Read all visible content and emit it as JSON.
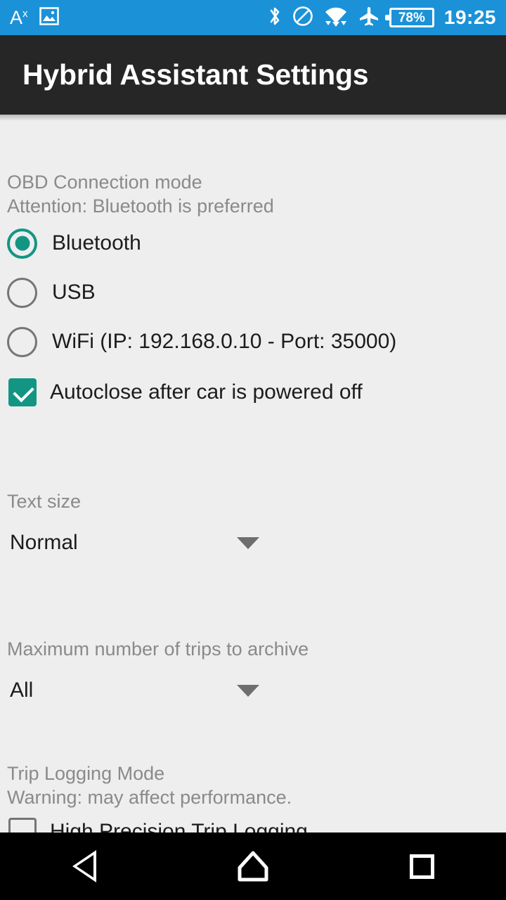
{
  "status_bar": {
    "left_icons": [
      {
        "name": "text-size-icon",
        "glyph": "A"
      },
      {
        "name": "screenshot-image-icon",
        "glyph": "image"
      }
    ],
    "right_icons": [
      {
        "name": "bluetooth-icon"
      },
      {
        "name": "do-not-disturb-icon"
      },
      {
        "name": "wifi-icon"
      },
      {
        "name": "airplane-mode-icon"
      }
    ],
    "battery": "78%",
    "time": "19:25",
    "background_color": "#1b92d8"
  },
  "title_bar": {
    "title": "Hybrid Assistant Settings",
    "background_color": "#262626"
  },
  "settings": {
    "obd_section": {
      "title": "OBD Connection mode",
      "subtitle": "Attention: Bluetooth is preferred",
      "options": [
        {
          "label": "Bluetooth",
          "selected": true
        },
        {
          "label": "USB",
          "selected": false
        },
        {
          "label": "WiFi (IP: 192.168.0.10 - Port: 35000)",
          "selected": false
        }
      ],
      "autoclose": {
        "label": "Autoclose after car is powered off",
        "checked": true
      }
    },
    "text_size": {
      "title": "Text size",
      "value": "Normal"
    },
    "max_trips": {
      "title": "Maximum number of trips to archive",
      "value": "All"
    },
    "trip_logging": {
      "title": "Trip Logging Mode",
      "subtitle": "Warning: may affect performance.",
      "option": {
        "label": "High Precision Trip Logging",
        "checked": false
      }
    }
  },
  "nav_bar": {
    "back": "back-button",
    "home": "home-button",
    "recents": "recents-button"
  },
  "accent_color": "#129683"
}
